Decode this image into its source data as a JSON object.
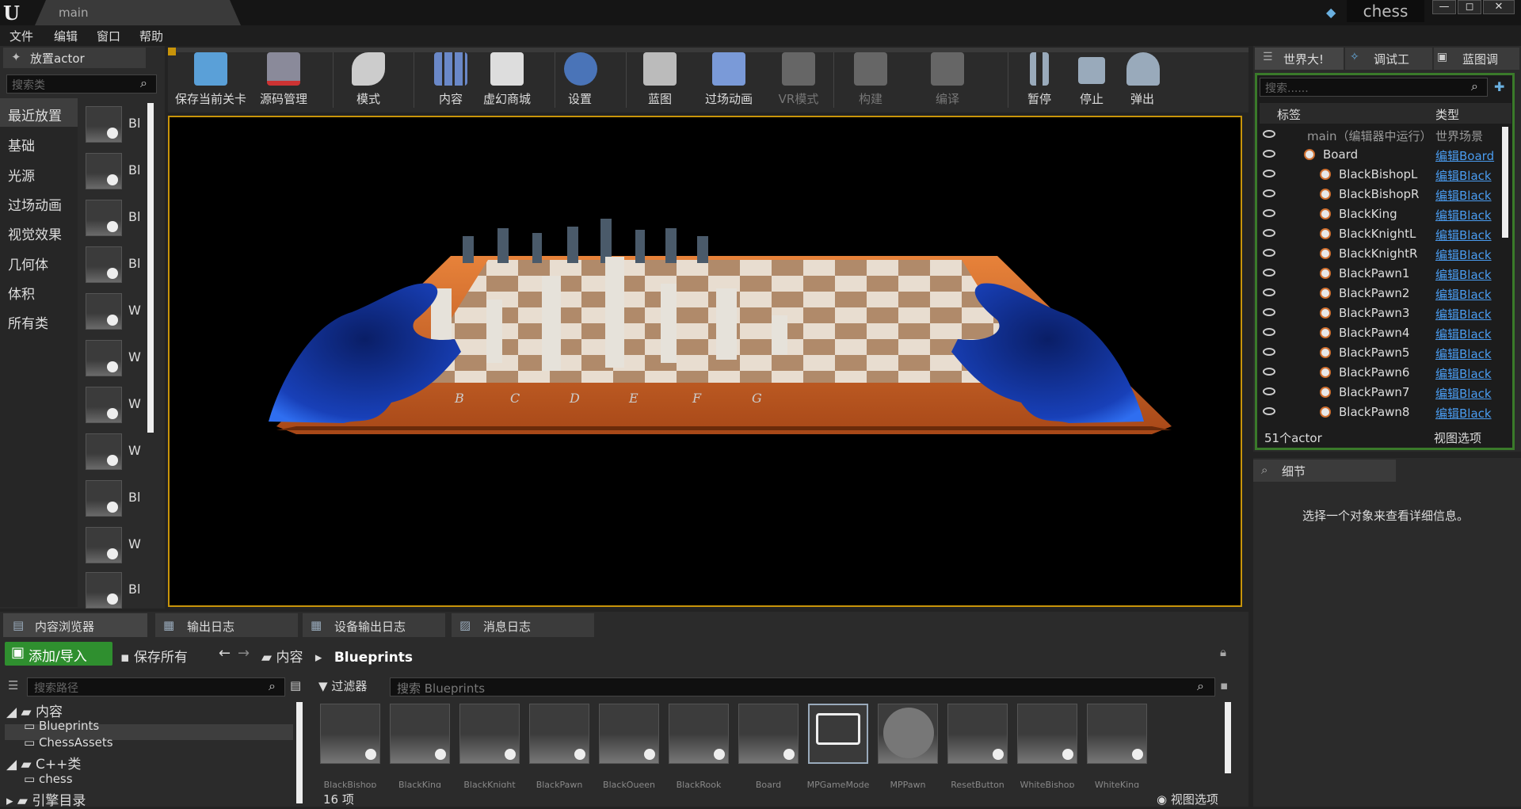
{
  "title_bar": {
    "tab": "main",
    "project": "chess",
    "window_buttons": [
      "—",
      "◻",
      "✕"
    ]
  },
  "menu": [
    "文件",
    "编辑",
    "窗口",
    "帮助"
  ],
  "place_panel": {
    "tab": "放置actor",
    "search_placeholder": "搜索类",
    "categories": [
      "最近放置",
      "基础",
      "光源",
      "过场动画",
      "视觉效果",
      "几何体",
      "体积",
      "所有类"
    ],
    "assets": [
      "Bl",
      "Bl",
      "Bl",
      "Bl",
      "W",
      "W",
      "W",
      "W",
      "Bl",
      "W",
      "Bl"
    ]
  },
  "toolbar": [
    {
      "label": "保存当前关卡",
      "icon": "save-icon"
    },
    {
      "label": "源码管理",
      "icon": "source-control-icon"
    },
    {
      "label": "模式",
      "icon": "modes-icon"
    },
    {
      "label": "内容",
      "icon": "content-icon"
    },
    {
      "label": "虚幻商城",
      "icon": "marketplace-icon"
    },
    {
      "label": "设置",
      "icon": "settings-icon"
    },
    {
      "label": "蓝图",
      "icon": "blueprint-icon"
    },
    {
      "label": "过场动画",
      "icon": "cinematics-icon"
    },
    {
      "label": "VR模式",
      "icon": "vr-icon"
    },
    {
      "label": "构建",
      "icon": "build-icon"
    },
    {
      "label": "编译",
      "icon": "compile-icon"
    },
    {
      "label": "暂停",
      "icon": "pause-icon"
    },
    {
      "label": "停止",
      "icon": "stop-icon"
    },
    {
      "label": "弹出",
      "icon": "eject-icon"
    }
  ],
  "viewport": {
    "board_letters": [
      "B",
      "C",
      "D",
      "E",
      "F",
      "G"
    ]
  },
  "outliner": {
    "tabs": [
      "世界大!",
      "调试工",
      "蓝图调"
    ],
    "search_placeholder": "搜索......",
    "col_label": "标签",
    "col_type": "类型",
    "root": {
      "name": "main（编辑器中运行）",
      "type": "世界场景"
    },
    "rows": [
      {
        "name": "Board",
        "type": "编辑Board"
      },
      {
        "name": "BlackBishopL",
        "type": "编辑Black"
      },
      {
        "name": "BlackBishopR",
        "type": "编辑Black"
      },
      {
        "name": "BlackKing",
        "type": "编辑Black"
      },
      {
        "name": "BlackKnightL",
        "type": "编辑Black"
      },
      {
        "name": "BlackKnightR",
        "type": "编辑Black"
      },
      {
        "name": "BlackPawn1",
        "type": "编辑Black"
      },
      {
        "name": "BlackPawn2",
        "type": "编辑Black"
      },
      {
        "name": "BlackPawn3",
        "type": "编辑Black"
      },
      {
        "name": "BlackPawn4",
        "type": "编辑Black"
      },
      {
        "name": "BlackPawn5",
        "type": "编辑Black"
      },
      {
        "name": "BlackPawn6",
        "type": "编辑Black"
      },
      {
        "name": "BlackPawn7",
        "type": "编辑Black"
      },
      {
        "name": "BlackPawn8",
        "type": "编辑Black"
      }
    ],
    "count": "51个actor",
    "view_options": "视图选项"
  },
  "details": {
    "tab": "细节",
    "message": "选择一个对象来查看详细信息。"
  },
  "bottom": {
    "tabs": [
      "内容浏览器",
      "输出日志",
      "设备输出日志",
      "消息日志"
    ],
    "add_import": "添加/导入",
    "save_all": "保存所有",
    "breadcrumb": [
      "内容",
      "Blueprints"
    ],
    "path_search_placeholder": "搜索路径",
    "tree": [
      {
        "label": "内容",
        "depth": 0
      },
      {
        "label": "Blueprints",
        "depth": 1
      },
      {
        "label": "ChessAssets",
        "depth": 1
      },
      {
        "label": "C++类",
        "depth": 0
      },
      {
        "label": "chess",
        "depth": 1
      },
      {
        "label": "引擎目录",
        "depth": 0
      }
    ],
    "filter": "过滤器",
    "search_placeholder": "搜索 Blueprints",
    "assets": [
      "BlackBishop",
      "BlackKing",
      "BlackKnight",
      "BlackPawn",
      "BlackQueen",
      "BlackRook",
      "Board",
      "MPGameMode",
      "MPPawn",
      "ResetButton",
      "WhiteBishop",
      "WhiteKing"
    ],
    "item_count": "16 项",
    "view_options": "视图选项"
  }
}
